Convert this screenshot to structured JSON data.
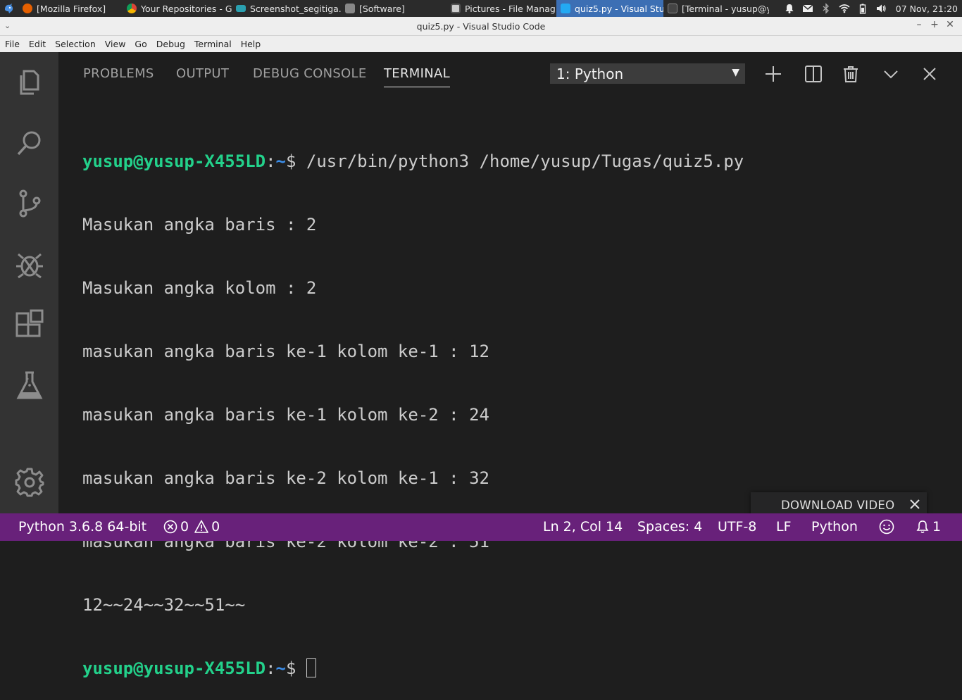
{
  "taskbar": {
    "tasks": [
      {
        "label": "[Mozilla Firefox]",
        "color": "#e66000",
        "active": false
      },
      {
        "label": "Your Repositories - G...",
        "color": "#4285f4",
        "active": false
      },
      {
        "label": "Screenshot_segitiga....",
        "color": "#2aa0b0",
        "active": false
      },
      {
        "label": "[Software]",
        "color": "#888888",
        "active": false
      },
      {
        "label": "Pictures - File Manag...",
        "color": "#cccccc",
        "active": false
      },
      {
        "label": "quiz5.py - Visual Stu...",
        "color": "#23a9f2",
        "active": true
      },
      {
        "label": "[Terminal - yusup@y...",
        "color": "#444444",
        "active": false
      }
    ],
    "clock": "07 Nov, 21:20"
  },
  "window": {
    "title": "quiz5.py - Visual Studio Code",
    "controls": [
      "–",
      "+",
      "✕"
    ]
  },
  "menu": [
    "File",
    "Edit",
    "Selection",
    "View",
    "Go",
    "Debug",
    "Terminal",
    "Help"
  ],
  "activity_bar": {
    "icons": [
      "explorer-icon",
      "search-icon",
      "source-control-icon",
      "debug-icon",
      "extensions-icon",
      "test-flask-icon",
      "gear-icon"
    ]
  },
  "panel": {
    "tabs": [
      "PROBLEMS",
      "OUTPUT",
      "DEBUG CONSOLE",
      "TERMINAL"
    ],
    "active_tab": "TERMINAL",
    "terminal_select": "1: Python",
    "buttons": [
      "add-icon",
      "split-icon",
      "trash-icon",
      "chevron-down-icon",
      "close-icon"
    ]
  },
  "terminal": {
    "prompt_user": "yusup@yusup-X455LD",
    "prompt_sep": ":",
    "prompt_path": "~",
    "prompt_symbol": "$ ",
    "command": "/usr/bin/python3 /home/yusup/Tugas/quiz5.py",
    "output": [
      "Masukan angka baris : 2",
      "Masukan angka kolom : 2",
      "masukan angka baris ke-1 kolom ke-1 : 12",
      "masukan angka baris ke-1 kolom ke-2 : 24",
      "masukan angka baris ke-2 kolom ke-1 : 32",
      "masukan angka baris ke-2 kolom ke-2 : 51",
      "12~~24~~32~~51~~"
    ]
  },
  "download_popup": {
    "label": "DOWNLOAD VIDEO"
  },
  "statusbar": {
    "interpreter": "Python 3.6.8 64-bit",
    "errors": "0",
    "warnings": "0",
    "position": "Ln 2, Col 14",
    "spaces": "Spaces: 4",
    "encoding": "UTF-8",
    "eol": "LF",
    "language": "Python",
    "notifications": "1"
  }
}
